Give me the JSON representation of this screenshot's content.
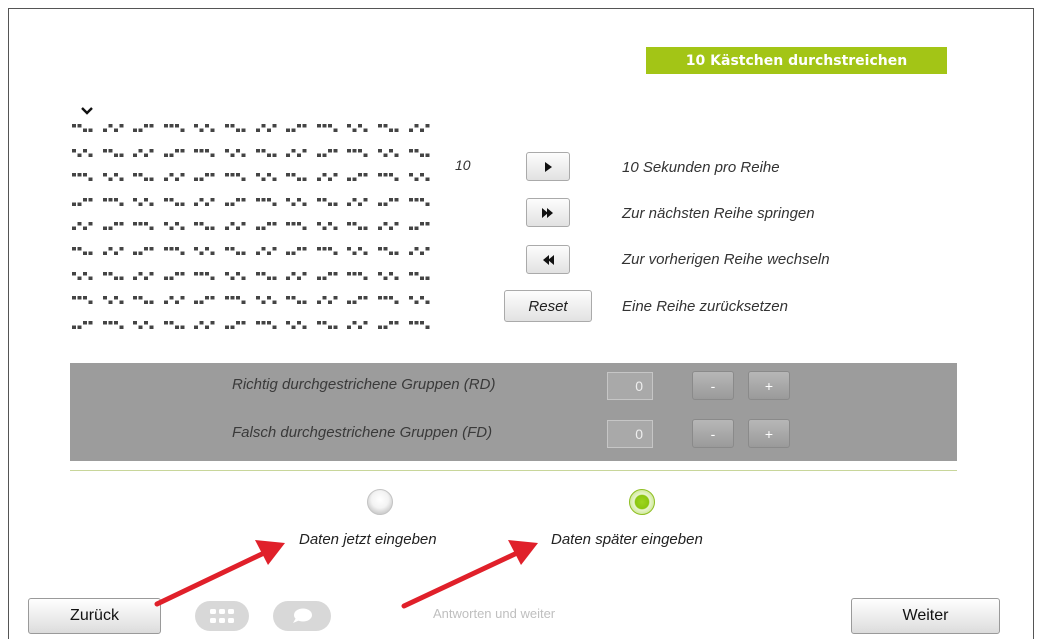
{
  "header": {
    "title": "10 Kästchen durchstreichen"
  },
  "counter": {
    "value": "10"
  },
  "controls": [
    {
      "icon": "play-icon",
      "label": "10 Sekunden pro Reihe"
    },
    {
      "icon": "fast-forward-icon",
      "label": "Zur nächsten Reihe springen"
    },
    {
      "icon": "rewind-icon",
      "label": "Zur vorherigen Reihe wechseln"
    },
    {
      "button": "Reset",
      "label": "Eine Reihe zurücksetzen"
    }
  ],
  "scoring": {
    "rd": {
      "label": "Richtig durchgestrichene Gruppen (RD)",
      "value": "0",
      "minus": "-",
      "plus": "+"
    },
    "fd": {
      "label": "Falsch durchgestrichene Gruppen (FD)",
      "value": "0",
      "minus": "-",
      "plus": "+"
    }
  },
  "options": {
    "now": {
      "label": "Daten jetzt eingeben",
      "selected": false
    },
    "later": {
      "label": "Daten später eingeben",
      "selected": true
    }
  },
  "footer": {
    "back": "Zurück",
    "next": "Weiter",
    "answer": "Antworten und weiter"
  },
  "colors": {
    "accent": "#a3c516",
    "panel": "#9c9c9c",
    "arrow": "#e0202a"
  }
}
